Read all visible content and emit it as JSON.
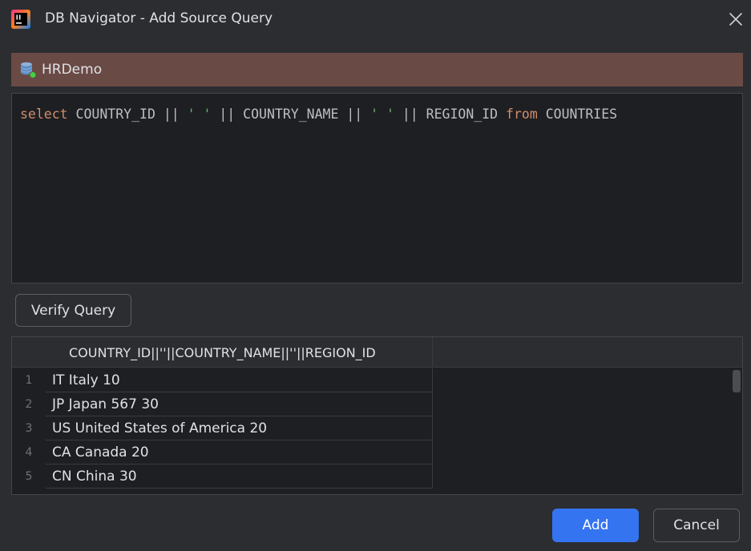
{
  "window": {
    "title": "DB Navigator - Add Source Query"
  },
  "connection": {
    "name": "HRDemo"
  },
  "editor": {
    "tokens": [
      {
        "text": "select",
        "kind": "kw"
      },
      {
        "text": " COUNTRY_ID || ",
        "kind": "plain"
      },
      {
        "text": "' '",
        "kind": "str"
      },
      {
        "text": " || COUNTRY_NAME || ",
        "kind": "plain"
      },
      {
        "text": "' '",
        "kind": "str"
      },
      {
        "text": " || REGION_ID ",
        "kind": "plain"
      },
      {
        "text": "from",
        "kind": "kw"
      },
      {
        "text": " COUNTRIES",
        "kind": "plain"
      }
    ]
  },
  "toolbar": {
    "verify_label": "Verify Query"
  },
  "results": {
    "column_header": "COUNTRY_ID||''||COUNTRY_NAME||''||REGION_ID",
    "rows": [
      {
        "num": "1",
        "value": "IT Italy 10"
      },
      {
        "num": "2",
        "value": "JP Japan 567 30"
      },
      {
        "num": "3",
        "value": "US United States of America 20"
      },
      {
        "num": "4",
        "value": "CA Canada 20"
      },
      {
        "num": "5",
        "value": "CN China 30"
      }
    ]
  },
  "footer": {
    "add_label": "Add",
    "cancel_label": "Cancel"
  },
  "colors": {
    "accent": "#3574f0",
    "connection_bar": "#6a4a45",
    "keyword": "#cf8e6d",
    "string": "#6aab73",
    "status_connected": "#3fd33f"
  },
  "icons": {
    "app": "intellij-app-icon",
    "close": "close-icon",
    "database": "database-connected-icon"
  }
}
